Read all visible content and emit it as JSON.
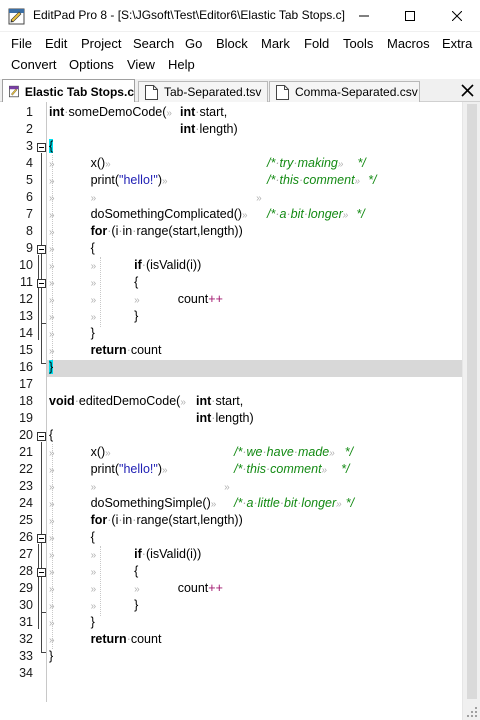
{
  "window": {
    "title": "EditPad Pro 8 - [S:\\JGsoft\\Test\\Editor6\\Elastic Tab Stops.c]",
    "minimize_glyph": "—",
    "maximize_glyph": "☐",
    "close_glyph": "✕"
  },
  "menu": {
    "row1": [
      "File",
      "Edit",
      "Project",
      "Search",
      "Go",
      "Block",
      "Mark",
      "Fold",
      "Tools",
      "Macros",
      "Extra"
    ],
    "row2": [
      "Convert",
      "Options",
      "View",
      "Help"
    ]
  },
  "tabs": [
    {
      "label": "Elastic Tab Stops.c",
      "active": true
    },
    {
      "label": "Tab-Separated.tsv",
      "active": false
    },
    {
      "label": "Comma-Separated.csv",
      "active": false
    }
  ],
  "editor": {
    "current_line": 16,
    "line_numbers": [
      "1",
      "2",
      "3",
      "4",
      "5",
      "6",
      "7",
      "8",
      "9",
      "10",
      "11",
      "12",
      "13",
      "14",
      "15",
      "16",
      "17",
      "18",
      "19",
      "20",
      "21",
      "22",
      "23",
      "24",
      "25",
      "26",
      "27",
      "28",
      "29",
      "30",
      "31",
      "32",
      "33",
      "34"
    ]
  },
  "colors": {
    "keyword": "#000000",
    "string": "#1e1eb4",
    "comment": "#138a13",
    "operator": "#a0166e",
    "brace_highlight": "#00e0f0",
    "current_line": "#d8d8d8"
  },
  "icons": {
    "app": "editpad-app-icon",
    "tab_active": "c-file-icon",
    "tab_other": "text-file-icon",
    "close_tab": "close-icon"
  },
  "code": {
    "l1a": "int",
    "l1b": "someDemoCode(",
    "l1c": "int",
    "l1d": "start,",
    "l2a": "int",
    "l2b": "length)",
    "l3": "{",
    "l4a": "x()",
    "l4b": "/*",
    "l4c": "try",
    "l4d": "making",
    "l4e": "*/",
    "l5a": "print(",
    "l5b": "\"hello!\"",
    "l5c": ")",
    "l5d": "/*",
    "l5e": "this",
    "l5f": "comment",
    "l5g": "*/",
    "l7a": "doSomethingComplicated()",
    "l7b": "/*",
    "l7c": "a",
    "l7d": "bit",
    "l7e": "longer",
    "l7f": "*/",
    "l8a": "for",
    "l8b": "(i",
    "l8c": "in",
    "l8d": "range(start,",
    "l8e": "length))",
    "l9": "{",
    "l10a": "if",
    "l10b": "(isValid(i))",
    "l11": "{",
    "l12a": "count",
    "l12b": "++",
    "l13": "}",
    "l14": "}",
    "l15a": "return",
    "l15b": "count",
    "l16": "}",
    "l18a": "void",
    "l18b": "editedDemoCode(",
    "l18c": "int",
    "l18d": "start,",
    "l19a": "int",
    "l19b": "length)",
    "l20": "{",
    "l21a": "x()",
    "l21b": "/*",
    "l21c": "we",
    "l21d": "have",
    "l21e": "made",
    "l21f": "*/",
    "l22a": "print(",
    "l22b": "\"hello!\"",
    "l22c": ")",
    "l22d": "/*",
    "l22e": "this",
    "l22f": "comment",
    "l22g": "*/",
    "l24a": "doSomethingSimple()",
    "l24b": "/*",
    "l24c": "a",
    "l24d": "little",
    "l24e": "bit",
    "l24f": "longer",
    "l24g": "*/",
    "l25a": "for",
    "l25b": "(i",
    "l25c": "in",
    "l25d": "range(start,",
    "l25e": "length))",
    "l26": "{",
    "l27a": "if",
    "l27b": "(isValid(i))",
    "l28": "{",
    "l29a": "count",
    "l29b": "++",
    "l30": "}",
    "l31": "}",
    "l32a": "return",
    "l32b": "count",
    "l33": "}"
  }
}
